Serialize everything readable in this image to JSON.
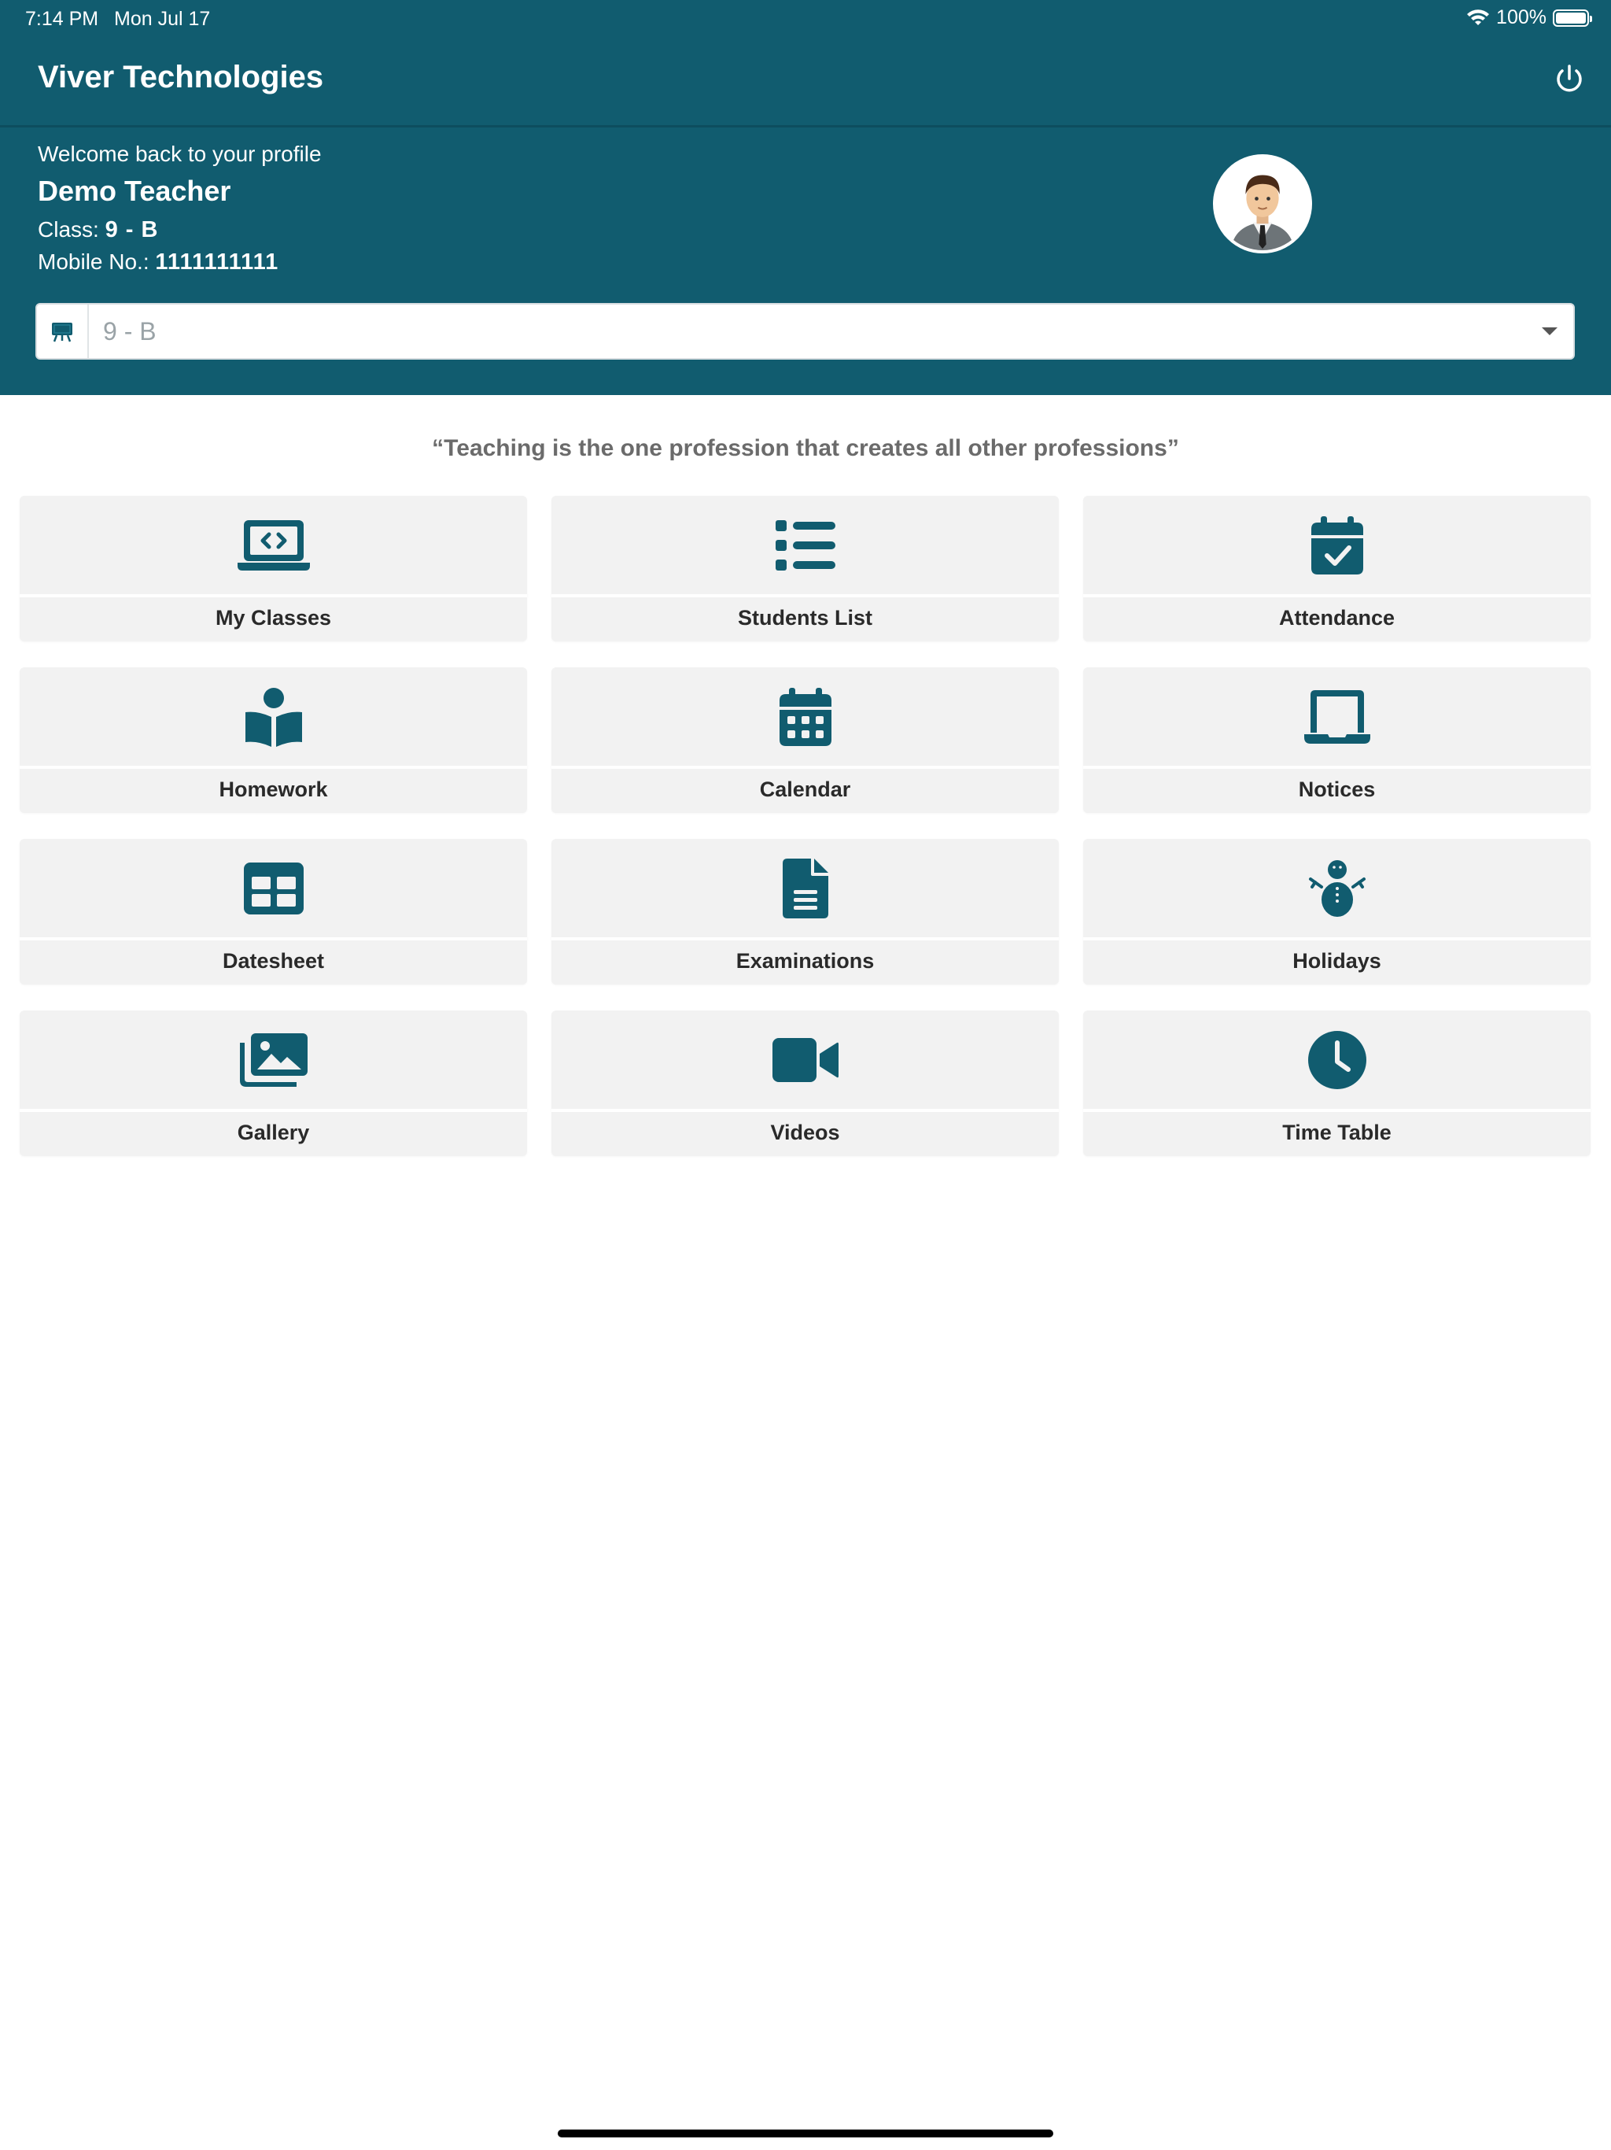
{
  "status": {
    "time": "7:14 PM",
    "date": "Mon Jul 17",
    "battery": "100%"
  },
  "app": {
    "title": "Viver Technologies"
  },
  "profile": {
    "welcome": "Welcome back to your profile",
    "name": "Demo Teacher",
    "class_label": "Class: ",
    "class_value": "9 - B",
    "mobile_label": "Mobile No.: ",
    "mobile_value": "1111111111"
  },
  "class_selector": {
    "value": "9 - B"
  },
  "quote": "“Teaching is the one profession that creates all other professions”",
  "tiles": [
    {
      "label": "My Classes",
      "icon": "laptop-code-icon"
    },
    {
      "label": "Students List",
      "icon": "list-icon"
    },
    {
      "label": "Attendance",
      "icon": "calendar-check-icon"
    },
    {
      "label": "Homework",
      "icon": "book-reader-icon"
    },
    {
      "label": "Calendar",
      "icon": "calendar-icon"
    },
    {
      "label": "Notices",
      "icon": "laptop-icon"
    },
    {
      "label": "Datesheet",
      "icon": "table-icon"
    },
    {
      "label": "Examinations",
      "icon": "file-icon"
    },
    {
      "label": "Holidays",
      "icon": "snowman-icon"
    },
    {
      "label": "Gallery",
      "icon": "images-icon"
    },
    {
      "label": "Videos",
      "icon": "video-camera-icon"
    },
    {
      "label": "Time Table",
      "icon": "clock-icon"
    }
  ],
  "colors": {
    "primary": "#115c6f",
    "tile_bg": "#f2f2f2",
    "icon": "#115c6f"
  }
}
